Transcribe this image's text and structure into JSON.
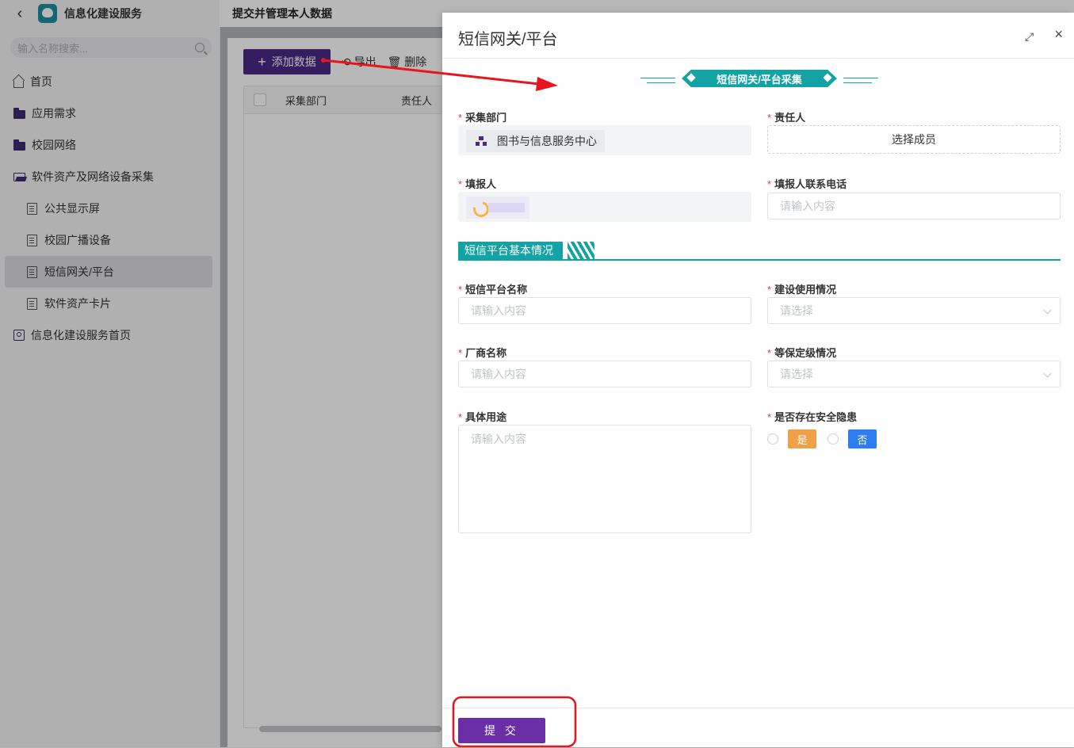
{
  "sidebar": {
    "app_title": "信息化建设服务",
    "search_placeholder": "输入名称搜索...",
    "items": [
      {
        "label": "首页"
      },
      {
        "label": "应用需求"
      },
      {
        "label": "校园网络"
      },
      {
        "label": "软件资产及网络设备采集"
      },
      {
        "label": "公共显示屏"
      },
      {
        "label": "校园广播设备"
      },
      {
        "label": "短信网关/平台"
      },
      {
        "label": "软件资产卡片"
      },
      {
        "label": "信息化建设服务首页"
      }
    ]
  },
  "main": {
    "title": "提交并管理本人数据",
    "toolbar": {
      "add_label": "添加数据",
      "export_label": "导出",
      "delete_label": "删除"
    },
    "table_headers": [
      "采集部门",
      "责任人"
    ]
  },
  "drawer": {
    "title": "短信网关/平台",
    "section_banner": "短信网关/平台采集",
    "fields": {
      "dept_label": "采集部门",
      "dept_value": "图书与信息服务中心",
      "owner_label": "责任人",
      "owner_button": "选择成员",
      "reporter_label": "填报人",
      "phone_label": "填报人联系电话",
      "phone_placeholder": "请输入内容",
      "platform_name_label": "短信平台名称",
      "platform_name_placeholder": "请输入内容",
      "usage_status_label": "建设使用情况",
      "usage_status_placeholder": "请选择",
      "vendor_label": "厂商名称",
      "vendor_placeholder": "请输入内容",
      "security_level_label": "等保定级情况",
      "security_level_placeholder": "请选择",
      "purpose_label": "具体用途",
      "purpose_placeholder": "请输入内容",
      "hazard_label": "是否存在安全隐患",
      "hazard_yes": "是",
      "hazard_no": "否"
    },
    "subsection": "短信平台基本情况",
    "submit_label": "提 交"
  },
  "colors": {
    "primary": "#4a2a86",
    "teal": "#13a3a4",
    "annotation": "#e8141e"
  }
}
